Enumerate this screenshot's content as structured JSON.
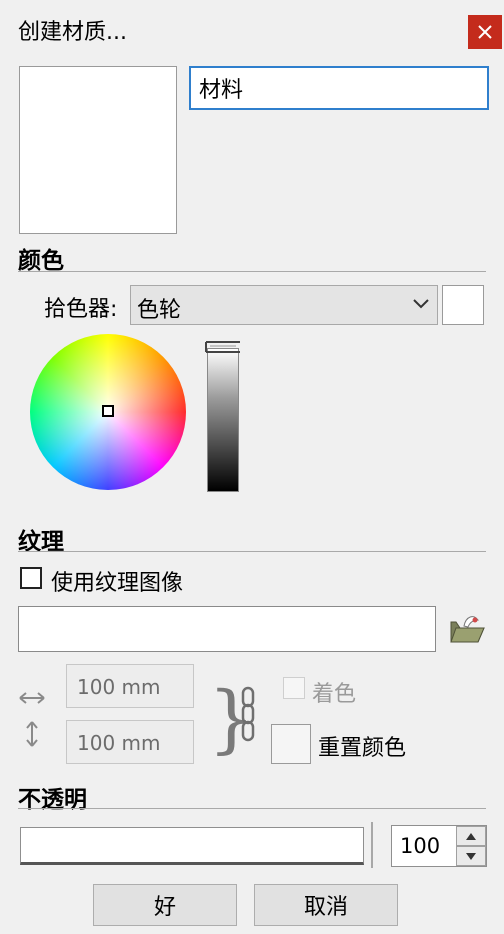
{
  "dialog": {
    "title": "创建材质...",
    "material_name": "材料"
  },
  "color_section": {
    "title": "颜色",
    "picker_label": "拾色器:",
    "picker_value": "色轮",
    "swatch_color": "#ffffff"
  },
  "texture_section": {
    "title": "纹理",
    "use_texture_label": "使用纹理图像",
    "use_texture_checked": false,
    "texture_path": "",
    "width": "100 mm",
    "height": "100 mm",
    "tint_label": "着色",
    "reset_color_label": "重置颜色"
  },
  "opacity_section": {
    "title": "不透明",
    "value": "100"
  },
  "buttons": {
    "ok_label": "好",
    "cancel_label": "取消"
  },
  "colors": {
    "close_button": "#c42b1c",
    "focus_border": "#2f7fcd"
  }
}
